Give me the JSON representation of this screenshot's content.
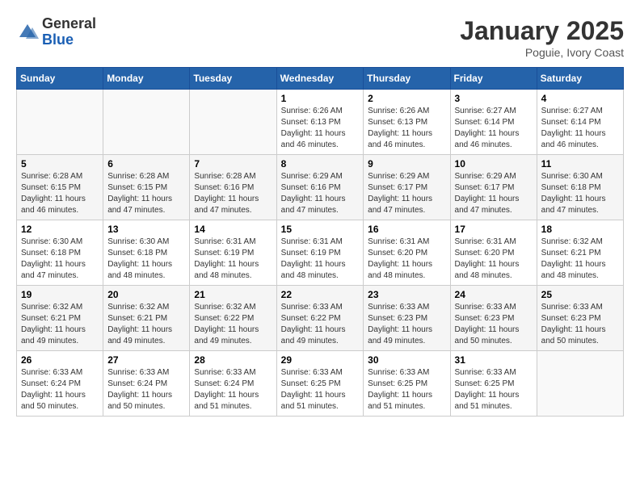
{
  "header": {
    "logo": {
      "general": "General",
      "blue": "Blue"
    },
    "title": "January 2025",
    "subtitle": "Poguie, Ivory Coast"
  },
  "weekdays": [
    "Sunday",
    "Monday",
    "Tuesday",
    "Wednesday",
    "Thursday",
    "Friday",
    "Saturday"
  ],
  "weeks": [
    [
      {
        "day": "",
        "info": ""
      },
      {
        "day": "",
        "info": ""
      },
      {
        "day": "",
        "info": ""
      },
      {
        "day": "1",
        "info": "Sunrise: 6:26 AM\nSunset: 6:13 PM\nDaylight: 11 hours\nand 46 minutes."
      },
      {
        "day": "2",
        "info": "Sunrise: 6:26 AM\nSunset: 6:13 PM\nDaylight: 11 hours\nand 46 minutes."
      },
      {
        "day": "3",
        "info": "Sunrise: 6:27 AM\nSunset: 6:14 PM\nDaylight: 11 hours\nand 46 minutes."
      },
      {
        "day": "4",
        "info": "Sunrise: 6:27 AM\nSunset: 6:14 PM\nDaylight: 11 hours\nand 46 minutes."
      }
    ],
    [
      {
        "day": "5",
        "info": "Sunrise: 6:28 AM\nSunset: 6:15 PM\nDaylight: 11 hours\nand 46 minutes."
      },
      {
        "day": "6",
        "info": "Sunrise: 6:28 AM\nSunset: 6:15 PM\nDaylight: 11 hours\nand 47 minutes."
      },
      {
        "day": "7",
        "info": "Sunrise: 6:28 AM\nSunset: 6:16 PM\nDaylight: 11 hours\nand 47 minutes."
      },
      {
        "day": "8",
        "info": "Sunrise: 6:29 AM\nSunset: 6:16 PM\nDaylight: 11 hours\nand 47 minutes."
      },
      {
        "day": "9",
        "info": "Sunrise: 6:29 AM\nSunset: 6:17 PM\nDaylight: 11 hours\nand 47 minutes."
      },
      {
        "day": "10",
        "info": "Sunrise: 6:29 AM\nSunset: 6:17 PM\nDaylight: 11 hours\nand 47 minutes."
      },
      {
        "day": "11",
        "info": "Sunrise: 6:30 AM\nSunset: 6:18 PM\nDaylight: 11 hours\nand 47 minutes."
      }
    ],
    [
      {
        "day": "12",
        "info": "Sunrise: 6:30 AM\nSunset: 6:18 PM\nDaylight: 11 hours\nand 47 minutes."
      },
      {
        "day": "13",
        "info": "Sunrise: 6:30 AM\nSunset: 6:18 PM\nDaylight: 11 hours\nand 48 minutes."
      },
      {
        "day": "14",
        "info": "Sunrise: 6:31 AM\nSunset: 6:19 PM\nDaylight: 11 hours\nand 48 minutes."
      },
      {
        "day": "15",
        "info": "Sunrise: 6:31 AM\nSunset: 6:19 PM\nDaylight: 11 hours\nand 48 minutes."
      },
      {
        "day": "16",
        "info": "Sunrise: 6:31 AM\nSunset: 6:20 PM\nDaylight: 11 hours\nand 48 minutes."
      },
      {
        "day": "17",
        "info": "Sunrise: 6:31 AM\nSunset: 6:20 PM\nDaylight: 11 hours\nand 48 minutes."
      },
      {
        "day": "18",
        "info": "Sunrise: 6:32 AM\nSunset: 6:21 PM\nDaylight: 11 hours\nand 48 minutes."
      }
    ],
    [
      {
        "day": "19",
        "info": "Sunrise: 6:32 AM\nSunset: 6:21 PM\nDaylight: 11 hours\nand 49 minutes."
      },
      {
        "day": "20",
        "info": "Sunrise: 6:32 AM\nSunset: 6:21 PM\nDaylight: 11 hours\nand 49 minutes."
      },
      {
        "day": "21",
        "info": "Sunrise: 6:32 AM\nSunset: 6:22 PM\nDaylight: 11 hours\nand 49 minutes."
      },
      {
        "day": "22",
        "info": "Sunrise: 6:33 AM\nSunset: 6:22 PM\nDaylight: 11 hours\nand 49 minutes."
      },
      {
        "day": "23",
        "info": "Sunrise: 6:33 AM\nSunset: 6:23 PM\nDaylight: 11 hours\nand 49 minutes."
      },
      {
        "day": "24",
        "info": "Sunrise: 6:33 AM\nSunset: 6:23 PM\nDaylight: 11 hours\nand 50 minutes."
      },
      {
        "day": "25",
        "info": "Sunrise: 6:33 AM\nSunset: 6:23 PM\nDaylight: 11 hours\nand 50 minutes."
      }
    ],
    [
      {
        "day": "26",
        "info": "Sunrise: 6:33 AM\nSunset: 6:24 PM\nDaylight: 11 hours\nand 50 minutes."
      },
      {
        "day": "27",
        "info": "Sunrise: 6:33 AM\nSunset: 6:24 PM\nDaylight: 11 hours\nand 50 minutes."
      },
      {
        "day": "28",
        "info": "Sunrise: 6:33 AM\nSunset: 6:24 PM\nDaylight: 11 hours\nand 51 minutes."
      },
      {
        "day": "29",
        "info": "Sunrise: 6:33 AM\nSunset: 6:25 PM\nDaylight: 11 hours\nand 51 minutes."
      },
      {
        "day": "30",
        "info": "Sunrise: 6:33 AM\nSunset: 6:25 PM\nDaylight: 11 hours\nand 51 minutes."
      },
      {
        "day": "31",
        "info": "Sunrise: 6:33 AM\nSunset: 6:25 PM\nDaylight: 11 hours\nand 51 minutes."
      },
      {
        "day": "",
        "info": ""
      }
    ]
  ]
}
